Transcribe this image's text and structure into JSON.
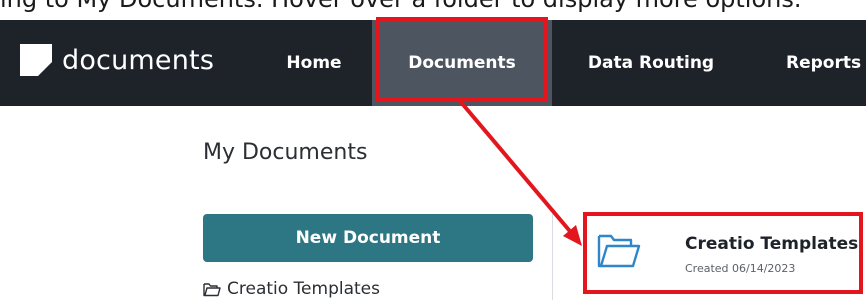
{
  "caption_fragment": "ing to My Documents. Hover over a folder to display more options.",
  "brand": {
    "name": "documents",
    "icon": "document-logo-icon"
  },
  "nav": {
    "home": "Home",
    "documents": "Documents",
    "data_routing": "Data Routing",
    "reports": "Reports"
  },
  "main": {
    "title": "My Documents",
    "new_document_label": "New Document",
    "tree_item_label": "Creatio Templates"
  },
  "folder_card": {
    "name": "Creatio Templates",
    "created": "Created 06/14/2023",
    "icon": "folder-icon"
  },
  "colors": {
    "navbar": "#1e2329",
    "active_nav": "#4d5660",
    "button": "#2d7683",
    "highlight": "#e3161e"
  }
}
